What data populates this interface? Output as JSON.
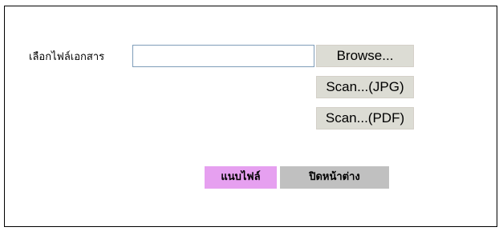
{
  "form": {
    "file_label": "เลือกไฟล์เอกสาร",
    "file_input_value": "",
    "browse_label": "Browse...",
    "scan_jpg_label": "Scan...(JPG)",
    "scan_pdf_label": "Scan...(PDF)",
    "attach_label": "แนบไฟล์",
    "close_label": "ปิดหน้าต่าง"
  },
  "colors": {
    "attach_button_bg": "#e6a0f0",
    "close_button_bg": "#c0c0c0",
    "scan_button_bg": "#dcdcd4",
    "frame_border": "#000000"
  }
}
